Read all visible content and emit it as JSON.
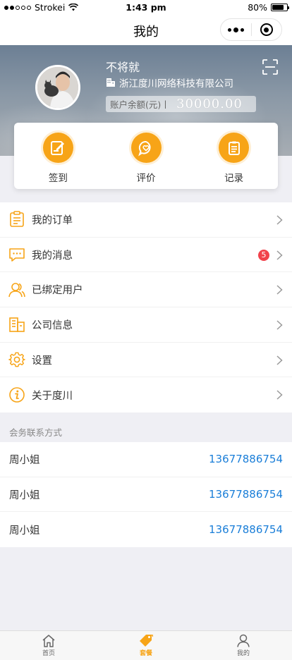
{
  "status_bar": {
    "carrier": "Strokei",
    "time": "1:43 pm",
    "battery": "80%",
    "battery_level": 0.8,
    "signal_bars_filled": 2,
    "signal_bars_total": 5
  },
  "nav": {
    "title": "我的"
  },
  "profile": {
    "name": "不将就",
    "company": "浙江度川网络科技有限公司",
    "balance_label": "账户余额(元)丨",
    "balance_value": "30000.00"
  },
  "actions": [
    {
      "label": "签到",
      "icon": "sign-in-icon"
    },
    {
      "label": "评价",
      "icon": "review-icon"
    },
    {
      "label": "记录",
      "icon": "record-icon"
    }
  ],
  "menu": [
    {
      "label": "我的订单",
      "icon": "order-icon"
    },
    {
      "label": "我的消息",
      "icon": "message-icon",
      "badge": "5"
    },
    {
      "label": "已绑定用户",
      "icon": "bound-users-icon"
    },
    {
      "label": "公司信息",
      "icon": "company-icon"
    },
    {
      "label": "设置",
      "icon": "settings-icon"
    },
    {
      "label": "关于度川",
      "icon": "about-icon"
    }
  ],
  "contacts_section": {
    "title": "会务联系方式",
    "items": [
      {
        "name": "周小姐",
        "phone": "13677886754"
      },
      {
        "name": "周小姐",
        "phone": "13677886754"
      },
      {
        "name": "周小姐",
        "phone": "13677886754"
      }
    ]
  },
  "tabbar": [
    {
      "label": "首页",
      "icon": "home-icon"
    },
    {
      "label": "套餐",
      "icon": "package-tag-icon",
      "active": true
    },
    {
      "label": "我的",
      "icon": "profile-icon"
    }
  ],
  "colors": {
    "accent": "#f7a417",
    "badge": "#f1424b",
    "link": "#1a7ed8"
  }
}
